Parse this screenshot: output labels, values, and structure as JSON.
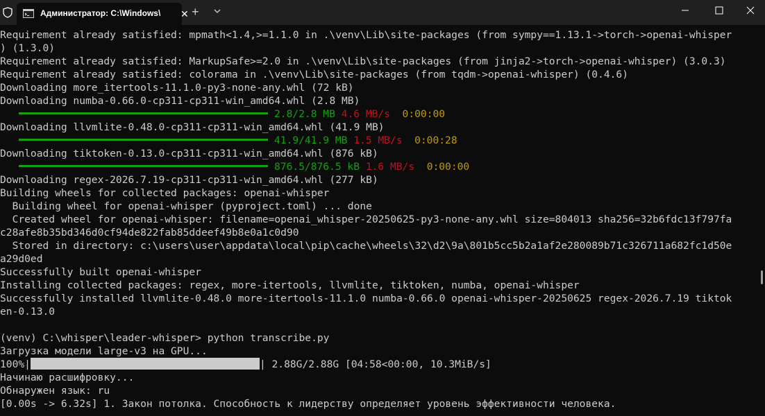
{
  "titlebar": {
    "tab_title": "Администратор: C:\\Windows\\",
    "close_glyph": "✕",
    "new_tab_glyph": "+"
  },
  "terminal": {
    "l1": "Requirement already satisfied: mpmath<1.4,>=1.1.0 in .\\venv\\Lib\\site-packages (from sympy==1.13.1->torch->openai-whisper",
    "l2": ") (1.3.0)",
    "l3": "Requirement already satisfied: MarkupSafe>=2.0 in .\\venv\\Lib\\site-packages (from jinja2->torch->openai-whisper) (3.0.3)",
    "l4": "Requirement already satisfied: colorama in .\\venv\\Lib\\site-packages (from tqdm->openai-whisper) (0.4.6)",
    "l5": "Downloading more_itertools-11.1.0-py3-none-any.whl (72 kB)",
    "l6": "Downloading numba-0.66.0-cp311-cp311-win_amd64.whl (2.8 MB)",
    "p1": {
      "size": "2.8/2.8 MB",
      "speed": "4.6 MB/s",
      "eta": "0:00:00",
      "fraction": 1.0
    },
    "l8": "Downloading llvmlite-0.48.0-cp311-cp311-win_amd64.whl (41.9 MB)",
    "p2": {
      "size": "41.9/41.9 MB",
      "speed": "1.5 MB/s",
      "eta": "0:00:28",
      "fraction": 1.0
    },
    "l10": "Downloading tiktoken-0.13.0-cp311-cp311-win_amd64.whl (876 kB)",
    "p3": {
      "size": "876.5/876.5 kB",
      "speed": "1.6 MB/s",
      "eta": "0:00:00",
      "fraction": 1.0
    },
    "l12": "Downloading regex-2026.7.19-cp311-cp311-win_amd64.whl (277 kB)",
    "l13": "Building wheels for collected packages: openai-whisper",
    "l14": "  Building wheel for openai-whisper (pyproject.toml) ... done",
    "l15": "  Created wheel for openai-whisper: filename=openai_whisper-20250625-py3-none-any.whl size=804013 sha256=32b6fdc13f797fa",
    "l16": "c28afe8b35bd346d0cf94de822fab85ddeef49b8e0a1c0d90",
    "l17": "  Stored in directory: c:\\users\\user\\appdata\\local\\pip\\cache\\wheels\\32\\d2\\9a\\801b5cc5b2a1af2e280089b71c326711a682fc1d50e",
    "l18": "a29d0ed",
    "l19": "Successfully built openai-whisper",
    "l20": "Installing collected packages: regex, more-itertools, llvmlite, tiktoken, numba, openai-whisper",
    "l21": "Successfully installed llvmlite-0.48.0 more-itertools-11.1.0 numba-0.66.0 openai-whisper-20250625 regex-2026.7.19 tiktok",
    "l22": "en-0.13.0",
    "l23": "",
    "l24": "(venv) C:\\whisper\\leader-whisper> python transcribe.py",
    "l25": "Загрузка модели large-v3 на GPU...",
    "gpu": {
      "percent": "100%|",
      "rest": "| 2.88G/2.88G [04:58<00:00, 10.3MiB/s]",
      "fraction": 1.0
    },
    "l27": "Начинаю расшифровку...",
    "l28": "Обнаружен язык: ru",
    "l29": "[0.00s -> 6.32s] 1. Закон потолка. Способность к лидерству определяет уровень эффективности человека."
  },
  "colors": {
    "background": "#0c0c0c",
    "text": "#cccccc",
    "progress_green": "#13a10e",
    "speed_red": "#c50f1f",
    "eta_yellow": "#c19c00",
    "titlebar": "#202020"
  },
  "icons": [
    "shield-icon",
    "terminal-icon",
    "close-icon",
    "plus-icon",
    "chevron-down-icon",
    "minimize-icon",
    "maximize-icon"
  ]
}
